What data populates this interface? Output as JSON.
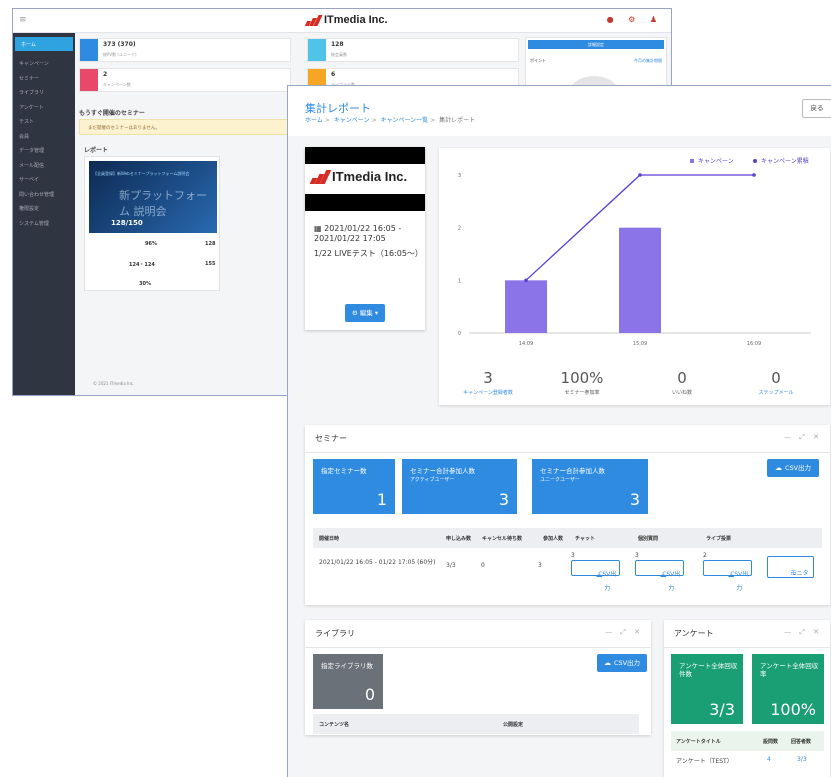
{
  "colors": {
    "accent": "#2f8be0",
    "bar": "#8b73e8",
    "line": "#5a3fd1",
    "tile_gray": "#6b7178",
    "tile_green": "#1a9e73"
  },
  "background_window": {
    "logo_text": "ITmedia Inc.",
    "sidebar": [
      "ホーム",
      "キャンペーン",
      "セミナー",
      "ライブラリ",
      "アンケート",
      "テスト",
      "会員",
      "データ管理",
      "メール配信",
      "サーベイ",
      "問い合わせ管理",
      "権限設定",
      "システム管理"
    ],
    "stats": [
      {
        "value": "373 (370)",
        "sub": "総PV数 (ユニーク)"
      },
      {
        "value": "128",
        "sub": "総会員数"
      },
      {
        "value": "2",
        "sub": "キャンペーン数"
      },
      {
        "value": "6",
        "sub": "ライブラリ数"
      }
    ],
    "upcoming_heading": "もうすぐ開催のセミナー",
    "upcoming_notice": "まだ開催のセミナーはありません。",
    "report_heading": "レポート",
    "card": {
      "banner": "【全員登録】新Webセミナープラットフォーム説明会",
      "ghost": "新プラットフォーム 説明会",
      "count": "128/150",
      "r1": "96%",
      "r1b": "128",
      "r2": "124・124",
      "r2b": "155",
      "r3": "30%"
    },
    "right_button": "詳細設定",
    "points_label": "ポイント",
    "points_link": "今月の集計期間",
    "footer": "© 2021 ITmedia Inc."
  },
  "report": {
    "title": "集計レポート",
    "breadcrumb": [
      "ホーム",
      "キャンペーン",
      "キャンペーン一覧",
      "集計レポート"
    ],
    "back_button": "戻る",
    "event": {
      "logo_text": "ITmedia Inc.",
      "date": "2021/01/22 16:05 - 2021/01/22 17:05",
      "title": "1/22 LIVEテスト（16:05～）",
      "edit_button": "編集"
    },
    "kpis": [
      {
        "value": "3",
        "label": "キャンペーン登録者数"
      },
      {
        "value": "100%",
        "label": "セミナー参加率"
      },
      {
        "value": "0",
        "label": "いいね数"
      },
      {
        "value": "0",
        "label": "ステップメール"
      }
    ],
    "seminar": {
      "title": "セミナー",
      "tiles": [
        {
          "label": "指定セミナー数",
          "sub": "",
          "value": "1"
        },
        {
          "label": "セミナー合計参加人数",
          "sub": "アクティブユーザー",
          "value": "3"
        },
        {
          "label": "セミナー合計参加人数",
          "sub": "ユニークユーザー",
          "value": "3"
        }
      ],
      "csv_button": "CSV出力",
      "columns": [
        "開催日時",
        "申し込み数",
        "キャンセル待ち数",
        "参加人数",
        "チャット",
        "個別質問",
        "ライブ投票"
      ],
      "row": {
        "datetime": "2021/01/22 16:05 - 01/22 17:05 (60分)",
        "applied": "3/3",
        "waiting": "0",
        "attended": "3",
        "chat": "3",
        "question": "3",
        "vote": "2"
      },
      "row_csv": "CSV出力",
      "monitor_button": "モニタ"
    },
    "library": {
      "title": "ライブラリ",
      "tile_label": "指定ライブラリ数",
      "tile_value": "0",
      "csv_button": "CSV出力",
      "columns": [
        "コンテンツ名",
        "公開設定"
      ]
    },
    "survey": {
      "title": "アンケート",
      "tiles": [
        {
          "label": "アンケート全体回収件数",
          "value": "3/3"
        },
        {
          "label": "アンケート全体回収率",
          "value": "100%"
        }
      ],
      "columns": [
        "アンケートタイトル",
        "設問数",
        "回答者数"
      ],
      "row": {
        "title": "アンケート（TEST）",
        "questions": "4",
        "answers": "3/3"
      }
    }
  },
  "chart_data": {
    "type": "bar",
    "categories": [
      "14:09",
      "15:09",
      "16:09"
    ],
    "series": [
      {
        "name": "キャンペーン",
        "type": "bar",
        "values": [
          1,
          2,
          0
        ]
      },
      {
        "name": "キャンペーン累積",
        "type": "line",
        "values": [
          1,
          3,
          3
        ]
      }
    ],
    "yticks": [
      0,
      1,
      2,
      3
    ],
    "ylim": [
      0,
      3
    ],
    "legend": "top-right",
    "grid": false
  }
}
